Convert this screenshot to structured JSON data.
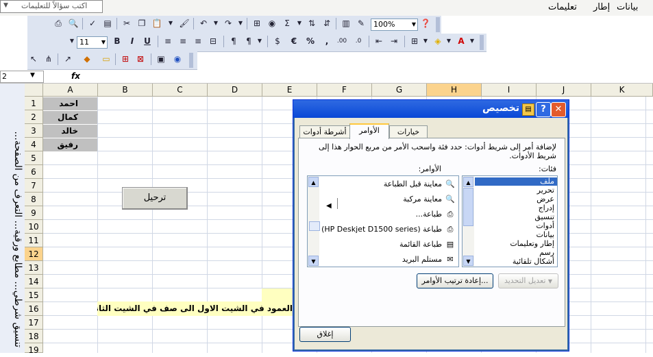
{
  "menubar": {
    "items": [
      "بيانات",
      "إطار",
      "تعليمات"
    ],
    "help_box_text": "اكتب سؤالاً للتعليمات"
  },
  "toolbar_standard": {
    "zoom": "100%"
  },
  "toolbar_format": {
    "font_size": "11",
    "bold": "B",
    "italic": "I",
    "underline": "U",
    "euro": "€",
    "percent": "%",
    "comma": ",",
    "inc_decimal": ".00",
    "dec_decimal": ".0",
    "sigma": "Σ"
  },
  "formula_bar": {
    "name_box": "2",
    "fx": "fx"
  },
  "task_pane": {
    "text": "تنسيق شرطي... مطابع ورقية... التعرف من الصفحة..."
  },
  "sheet": {
    "columns": [
      "A",
      "B",
      "C",
      "D",
      "E",
      "F",
      "G",
      "H",
      "I",
      "J",
      "K"
    ],
    "selected_column": "H",
    "rows": [
      "1",
      "2",
      "3",
      "4",
      "5",
      "6",
      "7",
      "8",
      "9",
      "10",
      "11",
      "12",
      "13",
      "14",
      "15",
      "16",
      "17",
      "18",
      "19"
    ],
    "selected_row": "12",
    "names": [
      "احمد",
      "كمال",
      "خالد",
      "رفيق"
    ],
    "button_label": "ترحيل",
    "note": "العمود  في الشيت الاول الى صف في الشيت الثاني"
  },
  "dialog": {
    "title": "تخصيص",
    "help": "?",
    "close": "✕",
    "tabs": [
      "أشرطة أدوات",
      "الأوامر",
      "خيارات"
    ],
    "active_tab": "الأوامر",
    "instruction": "لإضافة أمر إلى شريط أدوات: حدد فئة واسحب الأمر من مربع الحوار هذا إلى شريط الأدوات.",
    "categories_label": "فئات:",
    "commands_label": "الأوامر:",
    "categories": [
      "ملف",
      "تحرير",
      "عرض",
      "إدراج",
      "تنسيق",
      "أدوات",
      "بيانات",
      "إطار وتعليمات",
      "رسم",
      "أشكال تلقائية"
    ],
    "selected_category": "ملف",
    "commands": [
      "معاينة قبل الطباعة",
      "معاينة مركبة",
      "طباعة...",
      "طباعة (HP Deskjet D1500 series)",
      "طباعة القائمة",
      "مستلم البريد"
    ],
    "modify_selection": "تعديل التحديد",
    "rearrange_commands": "إعادة ترتيب الأوامر...",
    "close_button": "إغلاق"
  }
}
